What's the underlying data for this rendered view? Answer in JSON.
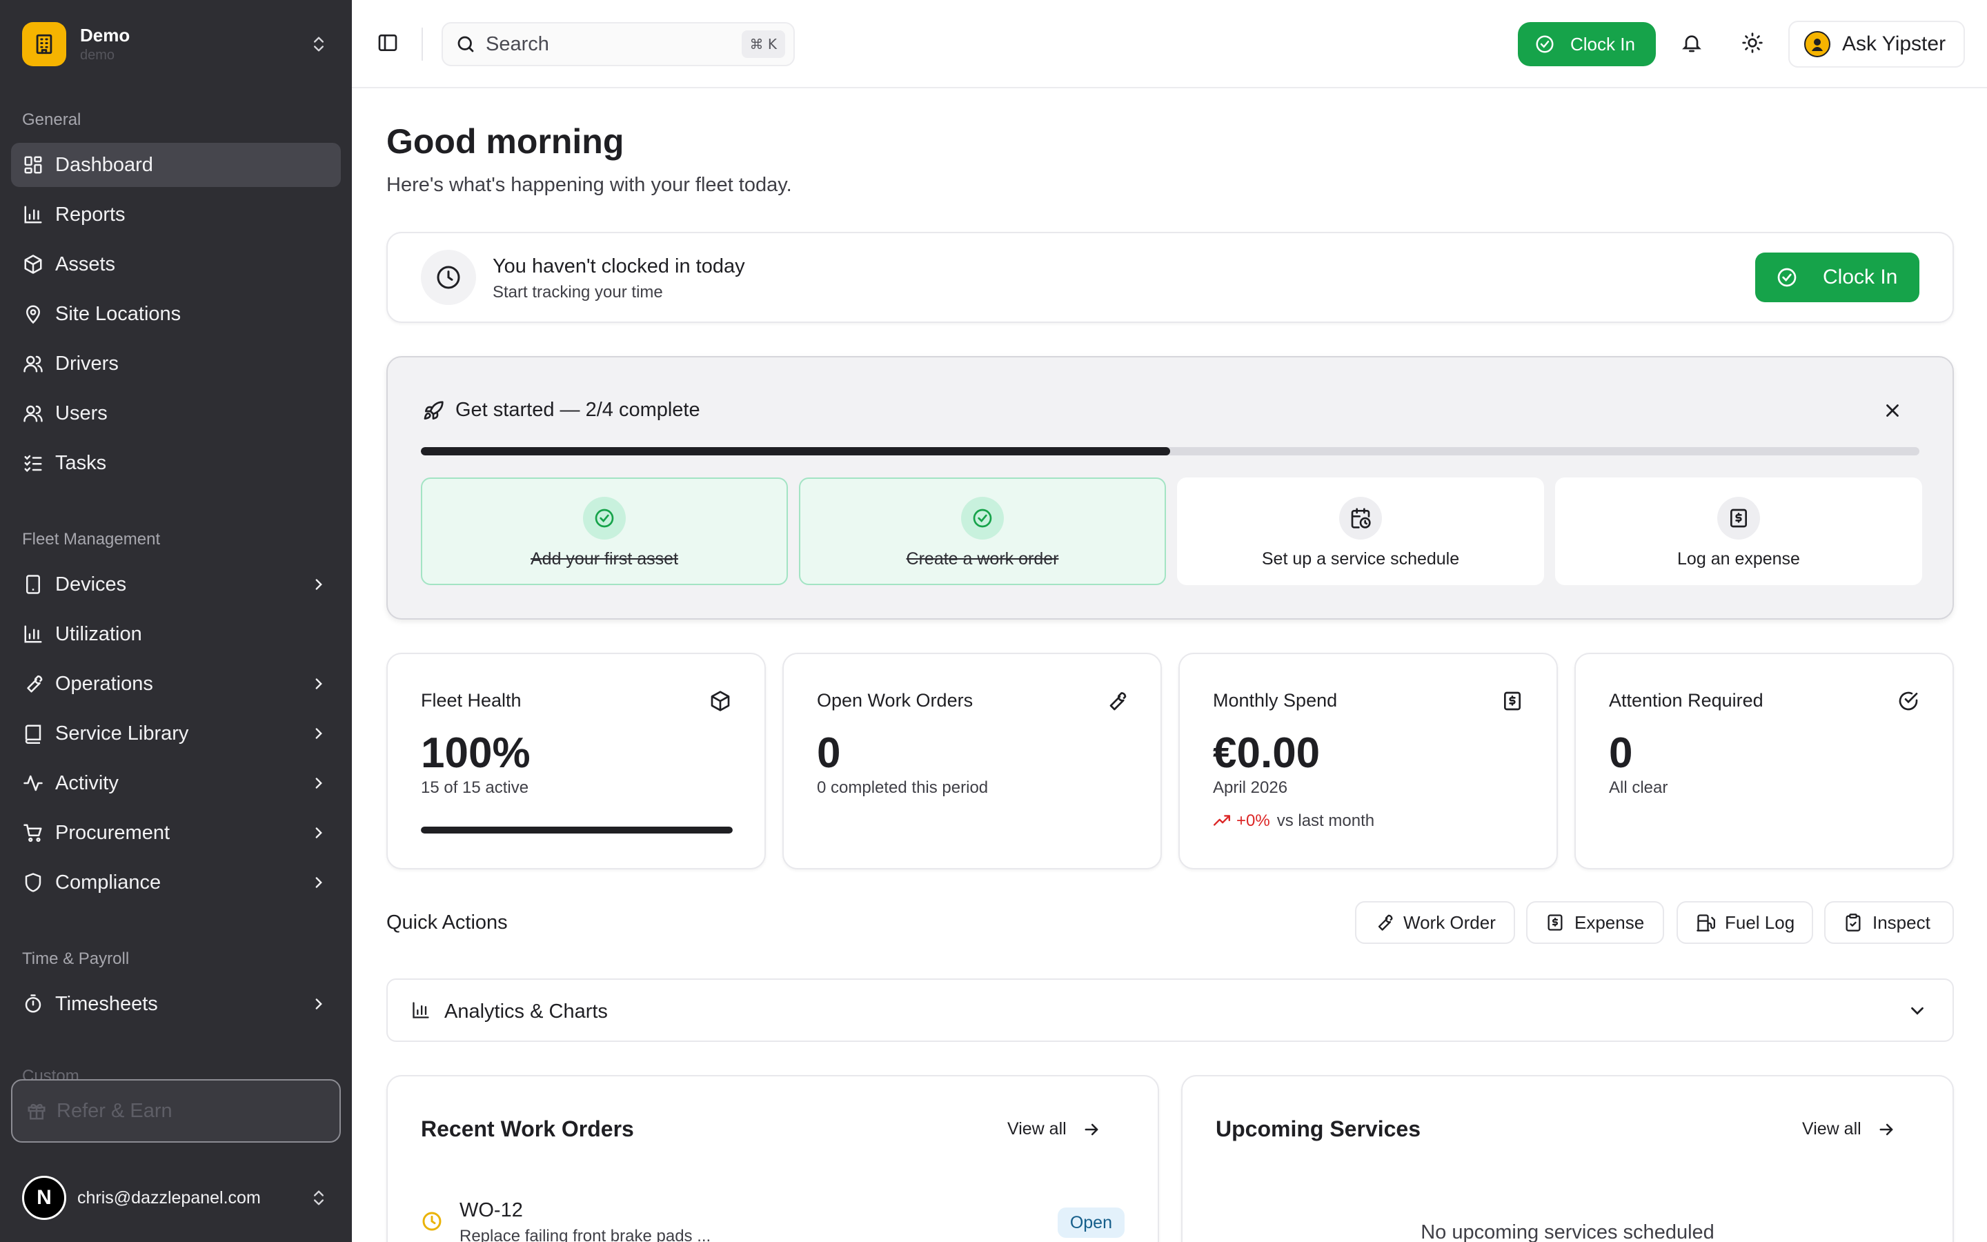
{
  "sidebar": {
    "org_name": "Demo",
    "org_sub": "demo",
    "sections": {
      "general": "General",
      "fleet": "Fleet Management",
      "time": "Time & Payroll",
      "custom": "Custom"
    },
    "general_items": [
      {
        "label": "Dashboard",
        "icon": "dashboard-icon",
        "active": true
      },
      {
        "label": "Reports",
        "icon": "bar-chart-icon"
      },
      {
        "label": "Assets",
        "icon": "box-icon"
      },
      {
        "label": "Site Locations",
        "icon": "map-pin-icon"
      },
      {
        "label": "Drivers",
        "icon": "users-icon"
      },
      {
        "label": "Users",
        "icon": "users-icon"
      },
      {
        "label": "Tasks",
        "icon": "list-checks-icon"
      }
    ],
    "fleet_items": [
      {
        "label": "Devices",
        "icon": "tablet-icon",
        "expandable": true
      },
      {
        "label": "Utilization",
        "icon": "bar-chart-icon"
      },
      {
        "label": "Operations",
        "icon": "wrench-icon",
        "expandable": true
      },
      {
        "label": "Service Library",
        "icon": "book-icon",
        "expandable": true
      },
      {
        "label": "Activity",
        "icon": "activity-icon",
        "expandable": true
      },
      {
        "label": "Procurement",
        "icon": "cart-icon",
        "expandable": true
      },
      {
        "label": "Compliance",
        "icon": "shield-icon",
        "expandable": true
      }
    ],
    "time_items": [
      {
        "label": "Timesheets",
        "icon": "timer-icon",
        "expandable": true
      }
    ],
    "refer_label": "Refer & Earn",
    "user_initial": "N",
    "user_email": "chris@dazzlepanel.com"
  },
  "topbar": {
    "search_label": "Search",
    "search_shortcut": "⌘ K",
    "clock_in_label": "Clock In",
    "ask_label": "Ask Yipster"
  },
  "greeting": {
    "title": "Good morning",
    "subtitle": "Here's what's happening with your fleet today."
  },
  "clock_card": {
    "title": "You haven't clocked in today",
    "subtitle": "Start tracking your time",
    "button": "Clock In"
  },
  "get_started": {
    "title": "Get started — 2/4 complete",
    "progress": 0.5,
    "steps": [
      {
        "label": "Add your first asset",
        "done": true,
        "icon": "check-circle-icon"
      },
      {
        "label": "Create a work order",
        "done": true,
        "icon": "check-circle-icon"
      },
      {
        "label": "Set up a service schedule",
        "done": false,
        "icon": "calendar-clock-icon"
      },
      {
        "label": "Log an expense",
        "done": false,
        "icon": "receipt-icon"
      }
    ]
  },
  "stats": [
    {
      "title": "Fleet Health",
      "value": "100%",
      "sub": "15 of 15 active",
      "icon": "box-icon",
      "progress": 1.0
    },
    {
      "title": "Open Work Orders",
      "value": "0",
      "sub": "0 completed this period",
      "icon": "wrench-icon"
    },
    {
      "title": "Monthly Spend",
      "value": "€0.00",
      "sub": "April 2026",
      "trend_pct": "+0%",
      "trend_text": "vs last month",
      "icon": "receipt-icon"
    },
    {
      "title": "Attention Required",
      "value": "0",
      "sub": "All clear",
      "icon": "check-circle-icon"
    }
  ],
  "quick_actions": {
    "title": "Quick Actions",
    "buttons": [
      {
        "label": "Work Order",
        "icon": "wrench-icon"
      },
      {
        "label": "Expense",
        "icon": "receipt-icon"
      },
      {
        "label": "Fuel Log",
        "icon": "fuel-icon"
      },
      {
        "label": "Inspect",
        "icon": "clipboard-check-icon"
      }
    ]
  },
  "analytics": {
    "title": "Analytics & Charts"
  },
  "recent_work_orders": {
    "title": "Recent Work Orders",
    "view_all": "View all",
    "items": [
      {
        "id": "WO-12",
        "description": "Replace failing front brake pads ...",
        "status": "Open"
      }
    ]
  },
  "upcoming_services": {
    "title": "Upcoming Services",
    "view_all": "View all",
    "empty": "No upcoming services scheduled"
  },
  "colors": {
    "sidebar_bg": "#2e2e33",
    "accent_green": "#16a34a",
    "brand_yellow": "#f6b400",
    "trend_red": "#dc2626"
  }
}
